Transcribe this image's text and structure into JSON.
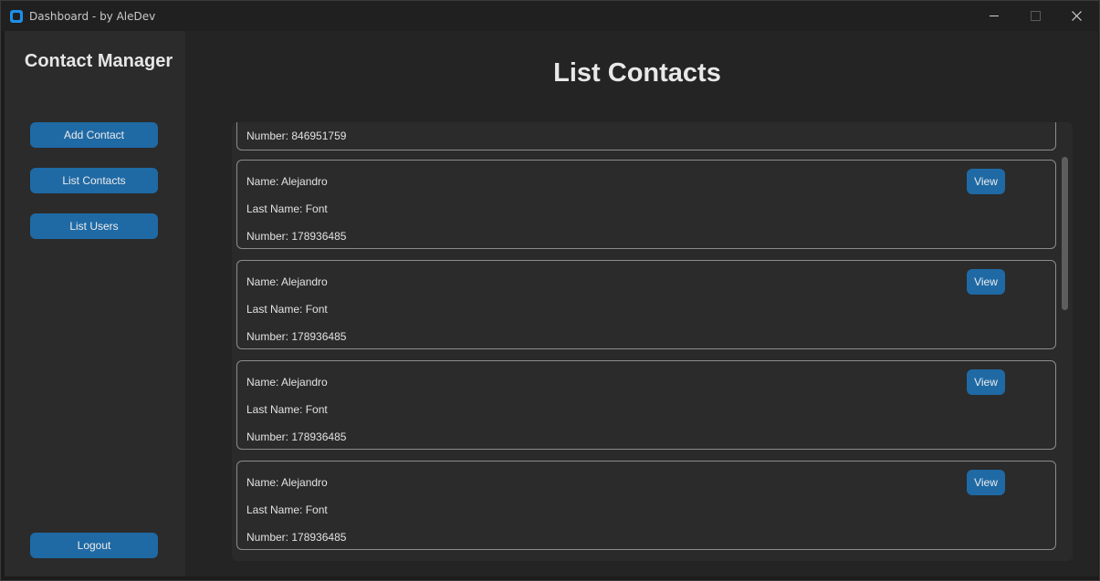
{
  "window": {
    "title": "Dashboard - by AleDev"
  },
  "sidebar": {
    "title": "Contact Manager",
    "buttons": {
      "add_contact": "Add Contact",
      "list_contacts": "List Contacts",
      "list_users": "List Users",
      "logout": "Logout"
    }
  },
  "main": {
    "title": "List Contacts",
    "view_label": "View",
    "partial_contact": {
      "number": "Number: 846951759"
    },
    "contacts": [
      {
        "name": "Name: Alejandro",
        "last_name": "Last Name: Font",
        "number": "Number: 178936485"
      },
      {
        "name": "Name: Alejandro",
        "last_name": "Last Name: Font",
        "number": "Number: 178936485"
      },
      {
        "name": "Name: Alejandro",
        "last_name": "Last Name: Font",
        "number": "Number: 178936485"
      },
      {
        "name": "Name: Alejandro",
        "last_name": "Last Name: Font",
        "number": "Number: 178936485"
      }
    ]
  },
  "colors": {
    "accent": "#1f6aa5",
    "app_icon": "#1e8fe8",
    "sidebar_bg": "#2b2b2b",
    "main_bg": "#242424"
  },
  "icons": {
    "app": "app-logo-icon",
    "minimize": "minimize-icon",
    "maximize": "maximize-icon",
    "close": "close-icon"
  }
}
